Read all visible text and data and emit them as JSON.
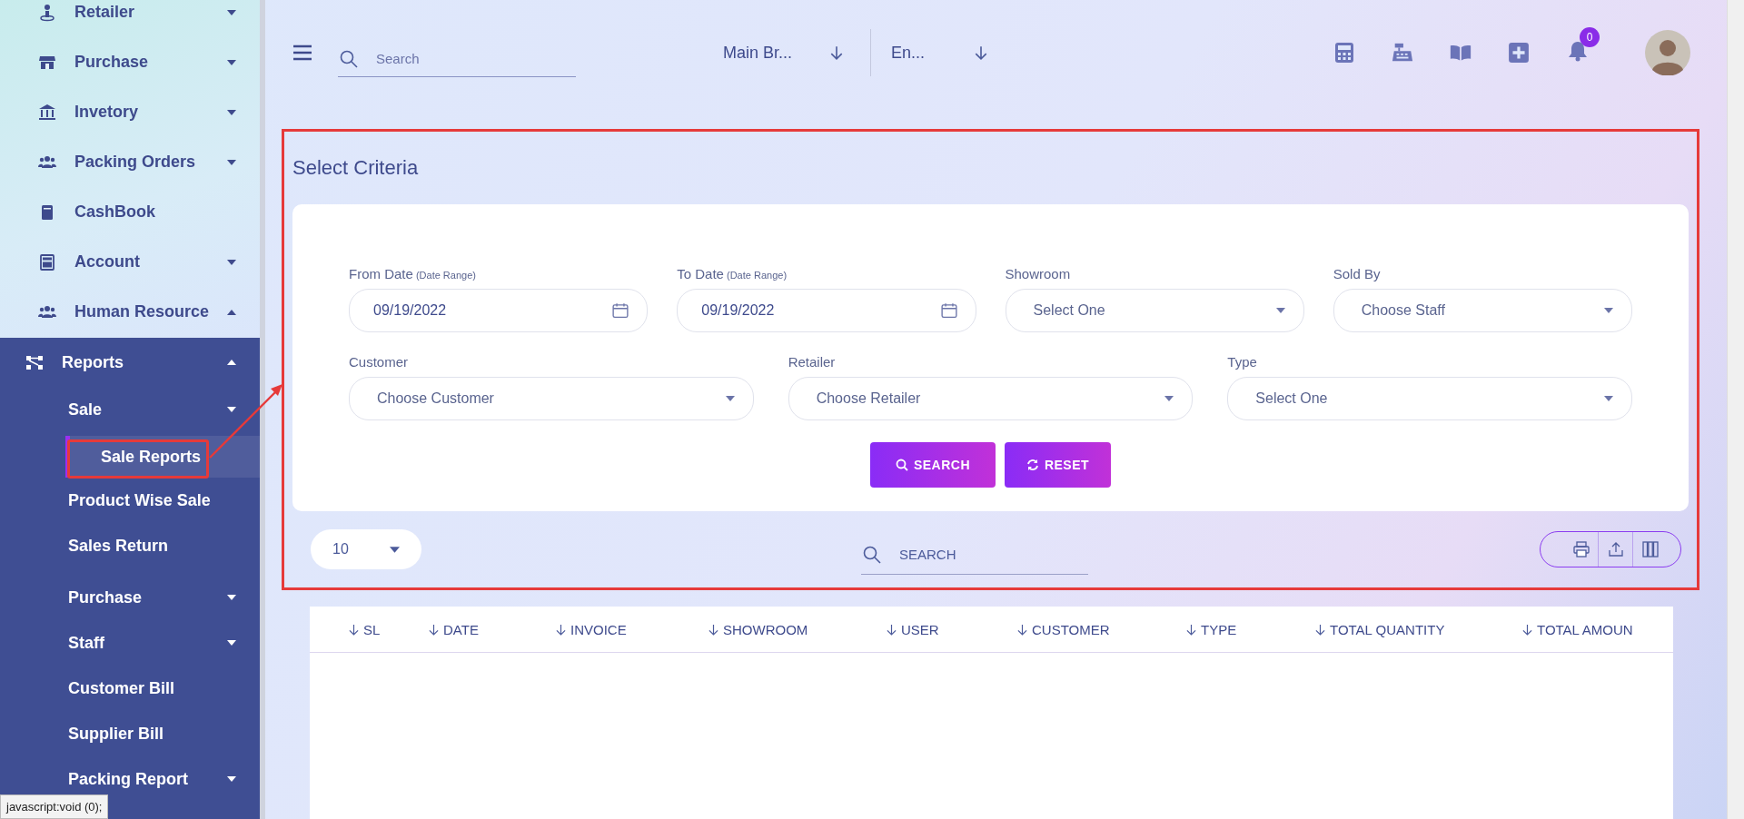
{
  "sidebar": {
    "items": [
      {
        "label": "Retailer",
        "expanded": false
      },
      {
        "label": "Purchase",
        "expanded": false
      },
      {
        "label": "Invetory",
        "expanded": false
      },
      {
        "label": "Packing Orders",
        "expanded": false
      },
      {
        "label": "CashBook"
      },
      {
        "label": "Account",
        "expanded": false
      },
      {
        "label": "Human Resource",
        "expanded": true
      }
    ],
    "reports": {
      "label": "Reports",
      "expanded": true,
      "children": [
        {
          "label": "Sale",
          "expanded": false,
          "children": [
            {
              "label": "Sale Reports",
              "selected": true
            },
            {
              "label": "Product Wise Sale",
              "selected": false
            },
            {
              "label": "Sales Return",
              "selected": false
            }
          ]
        },
        {
          "label": "Purchase",
          "expanded": false
        },
        {
          "label": "Staff",
          "expanded": false
        },
        {
          "label": "Customer Bill"
        },
        {
          "label": "Supplier Bill"
        },
        {
          "label": "Packing Report",
          "expanded": false
        }
      ]
    }
  },
  "topbar": {
    "search": {
      "placeholder": "Search"
    },
    "branch": "Main Br...",
    "language": "En...",
    "notifications": "0"
  },
  "criteria": {
    "title": "Select Criteria",
    "rows": [
      [
        {
          "kind": "date",
          "label": "From Date",
          "hint": "(Date Range)",
          "value": "09/19/2022"
        },
        {
          "kind": "date",
          "label": "To Date",
          "hint": "(Date Range)",
          "value": "09/19/2022"
        },
        {
          "kind": "select",
          "label": "Showroom",
          "value": "Select One"
        },
        {
          "kind": "select",
          "label": "Sold By",
          "value": "Choose Staff"
        }
      ],
      [
        {
          "kind": "select",
          "label": "Customer",
          "value": "Choose Customer"
        },
        {
          "kind": "select",
          "label": "Retailer",
          "value": "Choose Retailer"
        },
        {
          "kind": "select",
          "label": "Type",
          "value": "Select One"
        }
      ]
    ],
    "buttons": [
      {
        "kind": "search",
        "label": "SEARCH"
      },
      {
        "kind": "reset",
        "label": "RESET"
      }
    ]
  },
  "table_tools": {
    "page_size": "10",
    "search": {
      "placeholder": "SEARCH"
    }
  },
  "table": {
    "columns": [
      "SL",
      "DATE",
      "INVOICE",
      "SHOWROOM",
      "USER",
      "CUSTOMER",
      "TYPE",
      "TOTAL QUANTITY",
      "TOTAL AMOUN"
    ]
  },
  "status_tooltip": "javascript:void (0);"
}
